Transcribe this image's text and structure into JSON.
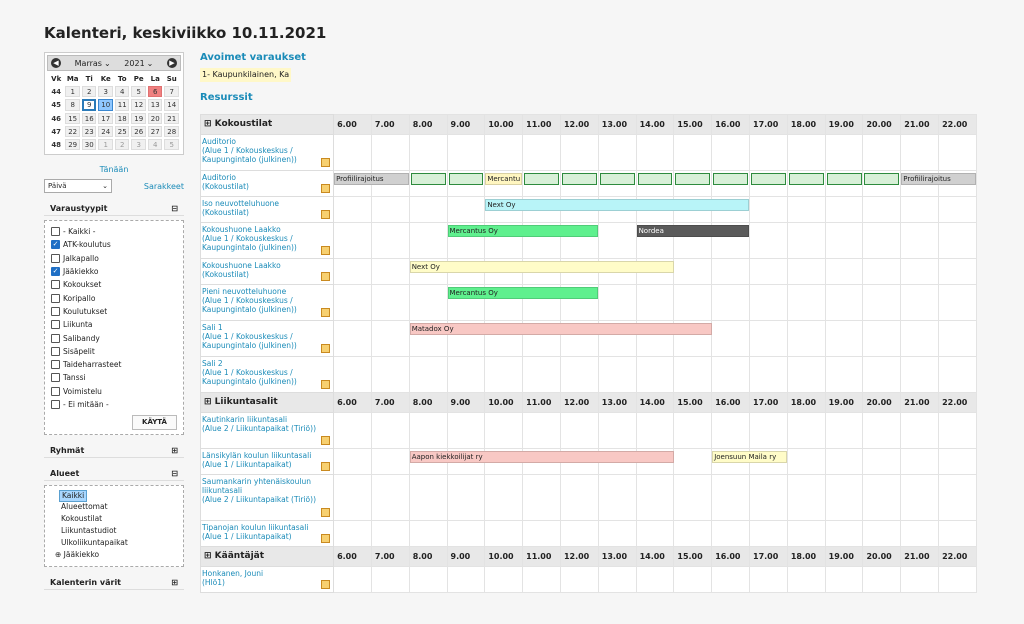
{
  "page_title": "Kalenteri, keskiviikko 10.11.2021",
  "calendar": {
    "month": "Marras",
    "year": "2021",
    "headers": [
      "Vk",
      "Ma",
      "Ti",
      "Ke",
      "To",
      "Pe",
      "La",
      "Su"
    ],
    "weeks": [
      [
        "44",
        "1",
        "2",
        "3",
        "4",
        "5",
        "6",
        "7"
      ],
      [
        "45",
        "8",
        "9",
        "10",
        "11",
        "12",
        "13",
        "14"
      ],
      [
        "46",
        "15",
        "16",
        "17",
        "18",
        "19",
        "20",
        "21"
      ],
      [
        "47",
        "22",
        "23",
        "24",
        "25",
        "26",
        "27",
        "28"
      ],
      [
        "48",
        "29",
        "30",
        "1",
        "2",
        "3",
        "4",
        "5"
      ]
    ]
  },
  "sidebar": {
    "today_link": "Tänään",
    "view_select": "Päivä",
    "columns_link": "Sarakkeet",
    "reservation_types_title": "Varaustyypit",
    "reservation_types": [
      {
        "label": "- Kaikki -",
        "checked": false
      },
      {
        "label": "ATK-koulutus",
        "checked": true
      },
      {
        "label": "Jalkapallo",
        "checked": false
      },
      {
        "label": "Jääkiekko",
        "checked": true
      },
      {
        "label": "Kokoukset",
        "checked": false
      },
      {
        "label": "Koripallo",
        "checked": false
      },
      {
        "label": "Koulutukset",
        "checked": false
      },
      {
        "label": "Liikunta",
        "checked": false
      },
      {
        "label": "Salibandy",
        "checked": false
      },
      {
        "label": "Sisäpelit",
        "checked": false
      },
      {
        "label": "Taideharrasteet",
        "checked": false
      },
      {
        "label": "Tanssi",
        "checked": false
      },
      {
        "label": "Voimistelu",
        "checked": false
      },
      {
        "label": "- Ei mitään -",
        "checked": false
      }
    ],
    "apply_button": "KÄYTÄ",
    "groups_title": "Ryhmät",
    "areas_title": "Alueet",
    "areas": [
      "Kaikki",
      "Alueettomat",
      "Kokoustilat",
      "Liikuntastudiot",
      "Ulkoliikuntapaikat",
      "Jääkiekko"
    ],
    "colors_title": "Kalenterin värit"
  },
  "main": {
    "open_title": "Avoimet varaukset",
    "open_item": "1- Kaupunkilainen, Ka",
    "resources_title": "Resurssit",
    "hours": [
      "6.00",
      "7.00",
      "8.00",
      "9.00",
      "10.00",
      "11.00",
      "12.00",
      "13.00",
      "14.00",
      "15.00",
      "16.00",
      "17.00",
      "18.00",
      "19.00",
      "20.00",
      "21.00",
      "22.00"
    ],
    "groups": [
      {
        "title": "Kokoustilat",
        "rows": [
          {
            "name": "Auditorio\n(Alue 1 / Kokouskeskus / Kaupungintalo (julkinen))",
            "h": 36,
            "events": []
          },
          {
            "name": "Auditorio\n(Kokoustilat)",
            "h": 26,
            "events": [
              {
                "label": "Profiilirajoitus",
                "start": 6,
                "end": 8,
                "color": "#d0d0d0"
              },
              {
                "label": "",
                "start": 8,
                "end": 10,
                "color": "#d8f0d8",
                "boxed": true
              },
              {
                "label": "Mercantu",
                "start": 10,
                "end": 11,
                "color": "#fff6c0"
              },
              {
                "label": "",
                "start": 11,
                "end": 21,
                "color": "#d8f0d8",
                "boxed": true
              },
              {
                "label": "Profiilirajoitus",
                "start": 21,
                "end": 23,
                "color": "#d0d0d0"
              }
            ]
          },
          {
            "name": "Iso neuvotteluhuone\n(Kokoustilat)",
            "h": 26,
            "events": [
              {
                "label": "Next Oy",
                "start": 10,
                "end": 17,
                "color": "#b8f4f8"
              }
            ]
          },
          {
            "name": "Kokoushuone Laakko\n(Alue 1 / Kokouskeskus / Kaupungintalo (julkinen))",
            "h": 36,
            "events": [
              {
                "label": "Mercantus Oy",
                "start": 9,
                "end": 13,
                "color": "#5ff08e"
              },
              {
                "label": "Nordea",
                "start": 14,
                "end": 17,
                "color": "#5a5a5a",
                "dark": true
              }
            ]
          },
          {
            "name": "Kokoushuone Laakko\n(Kokoustilat)",
            "h": 26,
            "events": [
              {
                "label": "Next Oy",
                "start": 8,
                "end": 15,
                "color": "#fffcc8"
              }
            ]
          },
          {
            "name": "Pieni neuvotteluhuone\n(Alue 1 / Kokouskeskus / Kaupungintalo (julkinen))",
            "h": 36,
            "events": [
              {
                "label": "Mercantus Oy",
                "start": 9,
                "end": 13,
                "color": "#5ff08e"
              }
            ]
          },
          {
            "name": "Sali 1\n(Alue 1 / Kokouskeskus / Kaupungintalo (julkinen))",
            "h": 36,
            "events": [
              {
                "label": "Matadox Oy",
                "start": 8,
                "end": 16,
                "color": "#f8c8c4"
              }
            ]
          },
          {
            "name": "Sali 2\n(Alue 1 / Kokouskeskus / Kaupungintalo (julkinen))",
            "h": 36,
            "events": []
          }
        ]
      },
      {
        "title": "Liikuntasalit",
        "rows": [
          {
            "name": "Kautinkarin liikuntasali\n(Alue 2 / Liikuntapaikat (Tiriö))",
            "h": 36,
            "events": []
          },
          {
            "name": "Länsikylän koulun liikuntasali\n(Alue 1 / Liikuntapaikat)",
            "h": 26,
            "events": [
              {
                "label": "Aapon kiekkoilijat ry",
                "start": 8,
                "end": 15,
                "color": "#f8c8c4"
              },
              {
                "label": "Joensuun Maila ry",
                "start": 16,
                "end": 18,
                "color": "#fffcc8"
              }
            ]
          },
          {
            "name": "Saumankarin yhtenäiskoulun liikuntasali\n(Alue 2 / Liikuntapaikat (Tiriö))",
            "h": 46,
            "events": []
          },
          {
            "name": "Tipanojan koulun liikuntasali\n(Alue 1 / Liikuntapaikat)",
            "h": 26,
            "events": []
          }
        ]
      },
      {
        "title": "Kääntäjät",
        "rows": [
          {
            "name": "Honkanen, Jouni\n(Hlö1)",
            "h": 26,
            "events": []
          }
        ]
      }
    ]
  }
}
